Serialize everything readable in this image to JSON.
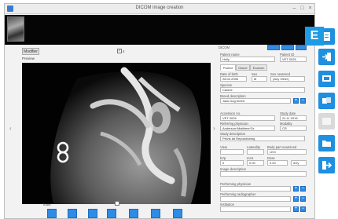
{
  "window": {
    "title": "DICOM image creation"
  },
  "left": {
    "modify_button": "Modifier",
    "preview_label": "Preview",
    "tools_label": "Tools"
  },
  "right": {
    "group_label": "DICOM",
    "patient_name_label": "Patient name",
    "patient_id_label": "Patient ID",
    "patient_name_value": "Holly",
    "patient_id_value": "VET 0026",
    "tabs": [
      "Patient",
      "Owner",
      "Examen"
    ],
    "dob_label": "Date of birth",
    "sex_label": "Sex",
    "sex_neutered_label": "Sex neutered",
    "dob_value": "28.02.2006",
    "sex_value": "M",
    "neutered_value": "(Any Other)",
    "species_label": "Species",
    "species_value": "Canine",
    "breed_label": "Breed description",
    "breed_value": "Jack Dog breed",
    "accession_label": "Accession no.",
    "study_date_label": "Study date",
    "accession_value": "VET 0026",
    "study_date_value": "24.11.2016",
    "referring_label": "Referring physician",
    "modality_label": "Modality",
    "referring_value": "Anderson^Matthew^Dr.",
    "modality_value": "CR",
    "study_desc_label": "Study description",
    "study_desc_value": "Pelvis lat Repositioning",
    "view_label": "View",
    "laterality_label": "Laterality",
    "body_part_label": "Body part examined",
    "view_value": "",
    "laterality_value": "",
    "body_part_value": "LEG",
    "kv_label": "kVp",
    "mas_label": "mAs",
    "dose_label": "Dose",
    "kv_value": "0",
    "mas_value": "0.00",
    "dose_value": "0.00",
    "dose_unit": "dGy",
    "image_desc_label": "Image description",
    "performing_physician_label": "Performing physician",
    "performing_radiographer_label": "Performing radiographer",
    "institution_label": "Institution"
  },
  "badge": "E"
}
